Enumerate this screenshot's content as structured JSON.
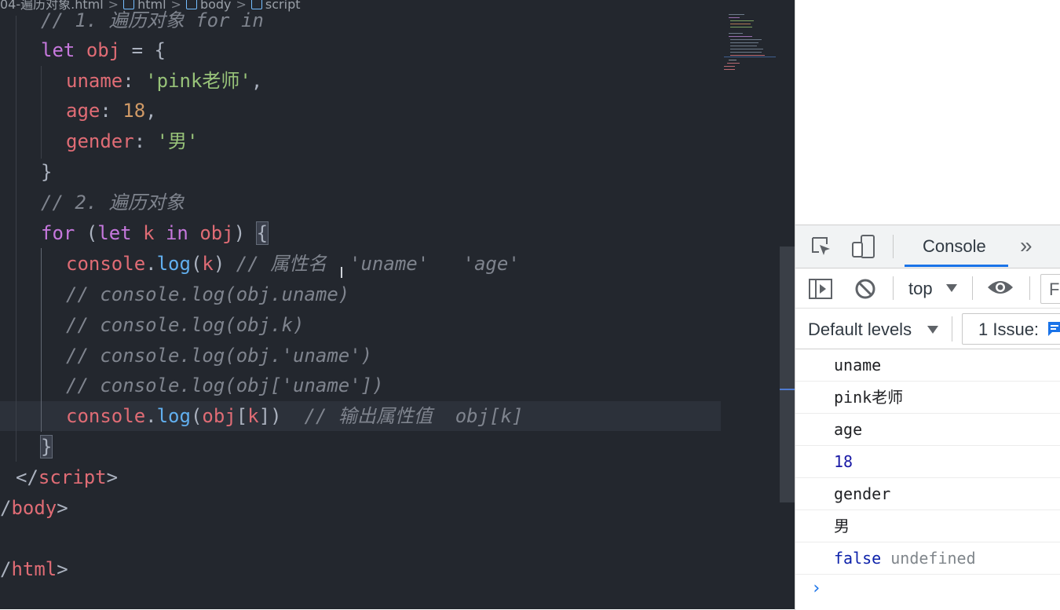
{
  "breadcrumb": {
    "file": "04-遍历对象.html",
    "items": [
      "html",
      "body",
      "script"
    ]
  },
  "code": {
    "l0_comment": "// 1. 遍历对象 for in",
    "l1": {
      "kw": "let",
      "name": "obj",
      "op": " = {"
    },
    "l2": {
      "key": "uname",
      "val": "'pink老师'"
    },
    "l3": {
      "key": "age",
      "val": "18"
    },
    "l4": {
      "key": "gender",
      "val": "'男'"
    },
    "l5": "}",
    "l6_comment": "// 2. 遍历对象",
    "l7": {
      "kw1": "for",
      "kw2": "let",
      "var": "k",
      "kw3": "in",
      "obj": "obj"
    },
    "l8": {
      "obj": "console",
      "fn": "log",
      "arg": "k",
      "comment": "// 属性名  'uname'   'age'"
    },
    "l9": "// console.log(obj.uname)",
    "l10": "// console.log(obj.k)",
    "l11": "// console.log(obj.'uname')",
    "l12": "// console.log(obj['uname'])",
    "l13": {
      "obj": "console",
      "fn": "log",
      "inner": "obj",
      "idx": "k",
      "comment": "// 输出属性值  obj[k]"
    },
    "l14": "}",
    "l15": "script",
    "l16": "body",
    "l17": "html"
  },
  "devtools": {
    "tab_console": "Console",
    "more": "»",
    "context": "top",
    "filter_placeholder": "Fi",
    "levels": "Default levels",
    "issues": "1 Issue:",
    "logs": [
      {
        "text": "uname",
        "type": "str"
      },
      {
        "text": "pink老师",
        "type": "str"
      },
      {
        "text": "age",
        "type": "str"
      },
      {
        "text": "18",
        "type": "num"
      },
      {
        "text": "gender",
        "type": "str"
      },
      {
        "text": "男",
        "type": "str"
      }
    ],
    "last_bool": "false",
    "last_undef": "undefined",
    "prompt": "›"
  },
  "colors": {
    "editor_bg": "#23272e",
    "keyword": "#c678dd",
    "variable": "#e06c75",
    "string": "#98c379",
    "number": "#d19a66",
    "function": "#61afef",
    "comment": "#7f848e",
    "accent": "#1a73e8"
  }
}
